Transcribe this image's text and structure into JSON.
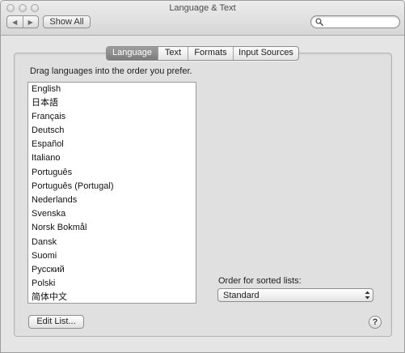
{
  "window": {
    "title": "Language & Text"
  },
  "toolbar": {
    "back_glyph": "◀",
    "forward_glyph": "▶",
    "show_all_label": "Show All",
    "search_placeholder": "",
    "search_value": ""
  },
  "tabs": [
    {
      "label": "Language",
      "active": true
    },
    {
      "label": "Text",
      "active": false
    },
    {
      "label": "Formats",
      "active": false
    },
    {
      "label": "Input Sources",
      "active": false
    }
  ],
  "language_pane": {
    "instruction": "Drag languages into the order you prefer.",
    "languages": [
      "English",
      "日本語",
      "Français",
      "Deutsch",
      "Español",
      "Italiano",
      "Português",
      "Português (Portugal)",
      "Nederlands",
      "Svenska",
      "Norsk Bokmål",
      "Dansk",
      "Suomi",
      "Русский",
      "Polski",
      "简体中文"
    ],
    "sort_order_label": "Order for sorted lists:",
    "sort_order_value": "Standard",
    "edit_list_label": "Edit List...",
    "help_label": "?"
  },
  "icons": {
    "search": "search-icon",
    "up_down": "up-down-arrows-icon",
    "back": "back-arrow-icon",
    "forward": "forward-arrow-icon"
  },
  "colors": {
    "active_tab": "#8a8a8a",
    "window_bg": "#e5e5e5"
  }
}
